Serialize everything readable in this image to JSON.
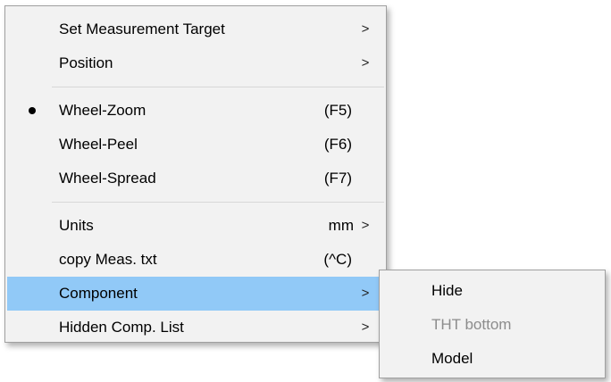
{
  "main_menu": {
    "items": [
      {
        "label": "Set Measurement Target",
        "arrow": ">"
      },
      {
        "label": "Position",
        "arrow": ">"
      },
      {
        "label": "Wheel-Zoom",
        "shortcut": "(F5)",
        "checked": true
      },
      {
        "label": "Wheel-Peel",
        "shortcut": "(F6)"
      },
      {
        "label": "Wheel-Spread",
        "shortcut": "(F7)"
      },
      {
        "label": "Units",
        "value": "mm",
        "arrow": ">"
      },
      {
        "label": "copy Meas. txt",
        "shortcut": "(^C)"
      },
      {
        "label": "Component",
        "arrow": ">",
        "selected": true
      },
      {
        "label": "Hidden Comp. List",
        "arrow": ">"
      }
    ]
  },
  "sub_menu": {
    "items": [
      {
        "label": "Hide"
      },
      {
        "label": "THT bottom",
        "disabled": true
      },
      {
        "label": "Model"
      }
    ]
  },
  "colors": {
    "menu_bg": "#f2f2f2",
    "highlight": "#91c9f7",
    "disabled_text": "#8c8c8c",
    "separator": "#d7d7d7"
  }
}
